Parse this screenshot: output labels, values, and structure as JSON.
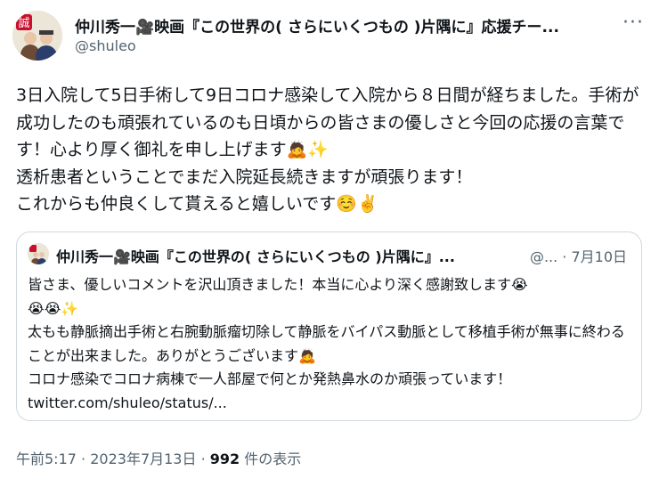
{
  "author": {
    "display_name": "仲川秀一🎥映画『この世界の( さらにいくつもの )片隅に』応援チー...",
    "handle": "@shuleo"
  },
  "header": {
    "more_label": "···"
  },
  "tweet": {
    "text": "3日入院して5日手術して9日コロナ感染して入院から８日間が経ちました。手術が成功したのも頑張れているのも日頃からの皆さまの優しさと今回の応援の言葉です！心より厚く御礼を申し上げます🙇✨\n透析患者ということでまだ入院延長続きますが頑張ります！\nこれからも仲良くして貰えると嬉しいです☺️✌️"
  },
  "quoted": {
    "display_name": "仲川秀一🎥映画『この世界の( さらにいくつもの )片隅に』...",
    "meta": "@...  · 7月10日",
    "text": "皆さま、優しいコメントを沢山頂きました！本当に心より深く感謝致します😭\n😭😭✨\n太もも静脈摘出手術と右腕動脈瘤切除して静脈をバイパス動脈として移植手術が無事に終わることが出来ました。ありがとうございます🙇\nコロナ感染でコロナ病棟で一人部屋で何とか発熱鼻水のか頑張っています！\ntwitter.com/shuleo/status/..."
  },
  "footer": {
    "time": "午前5:17",
    "date": "2023年7月13日",
    "views_count": "992",
    "views_label": "件の表示",
    "sep": "·"
  }
}
